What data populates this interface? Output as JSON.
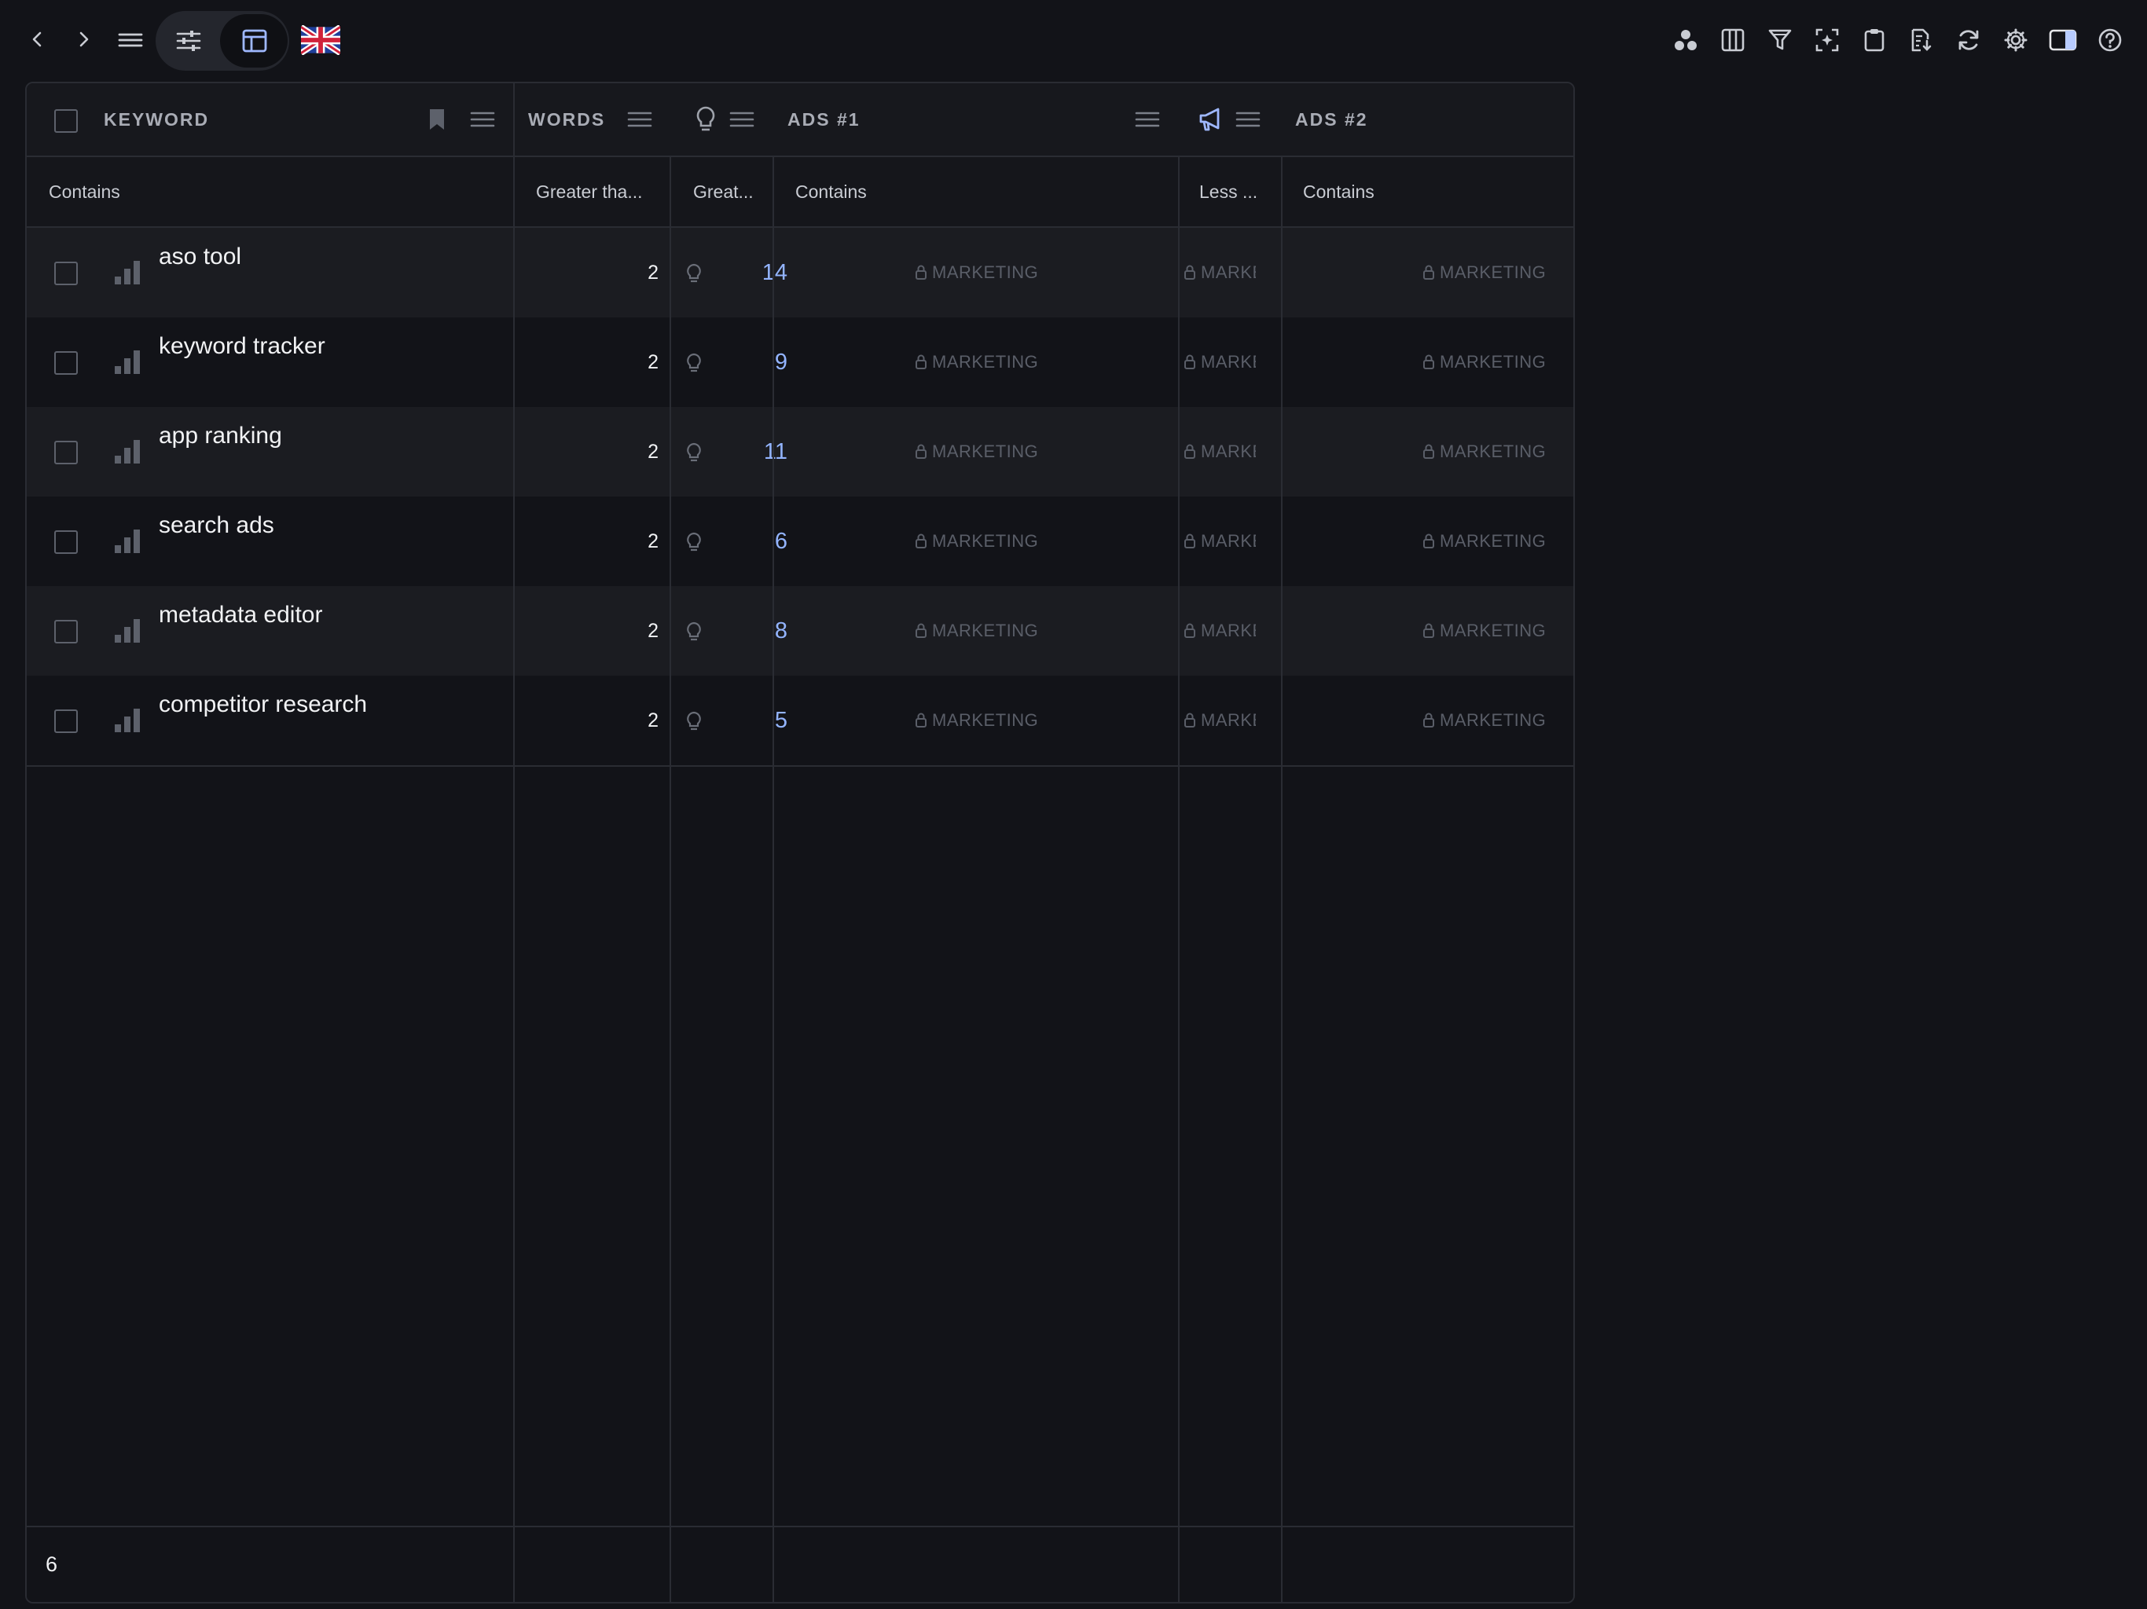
{
  "toolbar": {
    "language_flag": "uk-flag",
    "left_icons": [
      "chevron-left-icon",
      "chevron-right-icon",
      "menu-icon",
      "sliders-icon",
      "table-icon"
    ],
    "right_icons": [
      "dots-cluster-icon",
      "columns-icon",
      "filter-icon",
      "scan-icon",
      "clipboard-icon",
      "export-icon",
      "refresh-icon",
      "gear-icon",
      "sidebar-toggle-icon",
      "help-icon"
    ]
  },
  "table": {
    "headers": {
      "keyword": "KEYWORD",
      "words": "WORDS",
      "ads1": "ADS #1",
      "ads2": "ADS #2"
    },
    "filters": {
      "keyword": "Contains",
      "words": "Greater tha...",
      "popularity": "Great...",
      "ads1": "Contains",
      "ads_count": "Less ...",
      "ads2": "Contains"
    },
    "rows": [
      {
        "keyword": "aso tool",
        "words": "2",
        "popularity": "14",
        "ads1": "MARKETING",
        "ads_count": "MARKET",
        "ads2": "MARKETING"
      },
      {
        "keyword": "keyword tracker",
        "words": "2",
        "popularity": "9",
        "ads1": "MARKETING",
        "ads_count": "MARKET",
        "ads2": "MARKETING"
      },
      {
        "keyword": "app ranking",
        "words": "2",
        "popularity": "11",
        "ads1": "MARKETING",
        "ads_count": "MARKET",
        "ads2": "MARKETING"
      },
      {
        "keyword": "search ads",
        "words": "2",
        "popularity": "6",
        "ads1": "MARKETING",
        "ads_count": "MARKET",
        "ads2": "MARKETING"
      },
      {
        "keyword": "metadata editor",
        "words": "2",
        "popularity": "8",
        "ads1": "MARKETING",
        "ads_count": "MARKET",
        "ads2": "MARKETING"
      },
      {
        "keyword": "competitor research",
        "words": "2",
        "popularity": "5",
        "ads1": "MARKETING",
        "ads_count": "MARKET",
        "ads2": "MARKETING"
      }
    ],
    "footer_count": "6"
  },
  "colors": {
    "background": "#121318",
    "accent": "#93b4ff",
    "row_alt": "#1b1c21",
    "border": "#2a2c33",
    "muted": "#5a5e68"
  }
}
